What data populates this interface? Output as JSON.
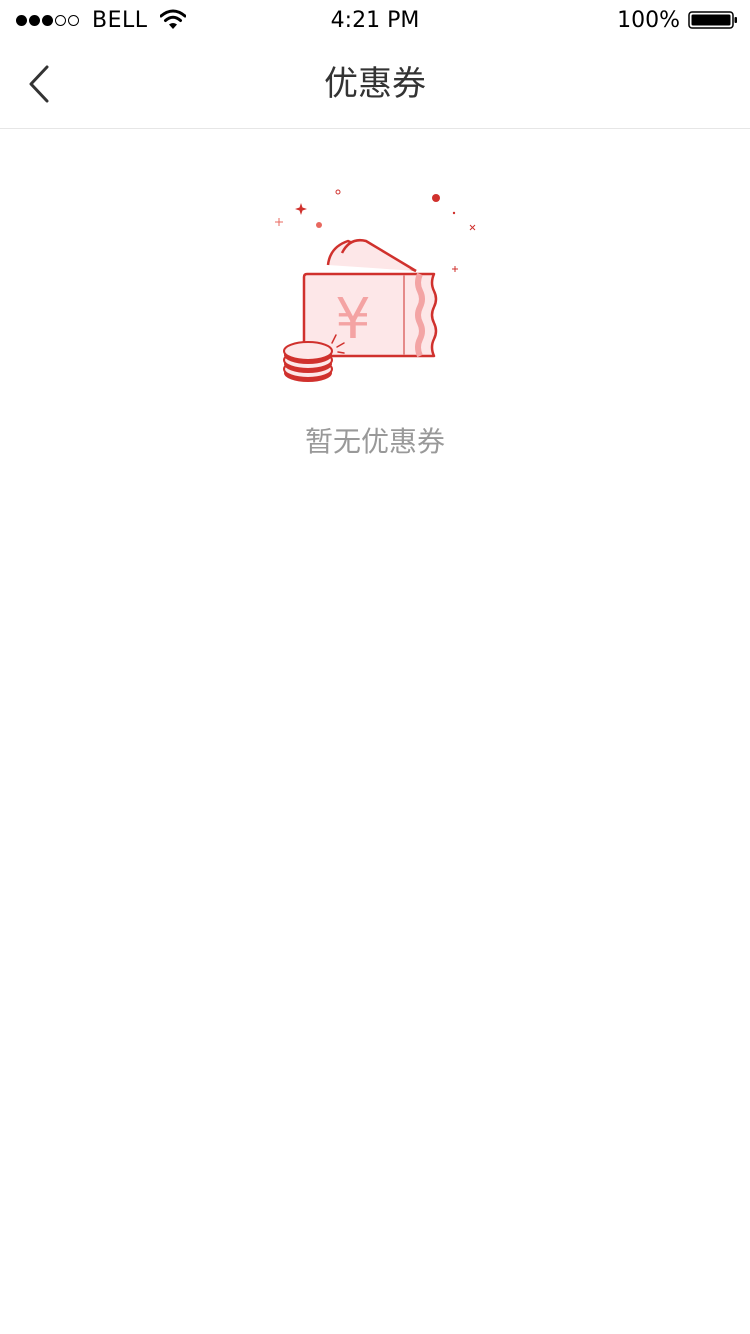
{
  "status_bar": {
    "carrier": "BELL",
    "time": "4:21 PM",
    "battery": "100%",
    "signal_filled": 3,
    "signal_total": 5
  },
  "nav": {
    "title": "优惠券",
    "back_icon": "chevron-left-icon"
  },
  "empty_state": {
    "message": "暂无优惠券",
    "illustration_currency": "¥",
    "illustration_icon": "coupon-wallet-icon"
  },
  "colors": {
    "accent": "#d0312d",
    "accent_light": "#fde7e8",
    "text_primary": "#333333",
    "text_secondary": "#999999",
    "divider": "#e6e6e6"
  }
}
